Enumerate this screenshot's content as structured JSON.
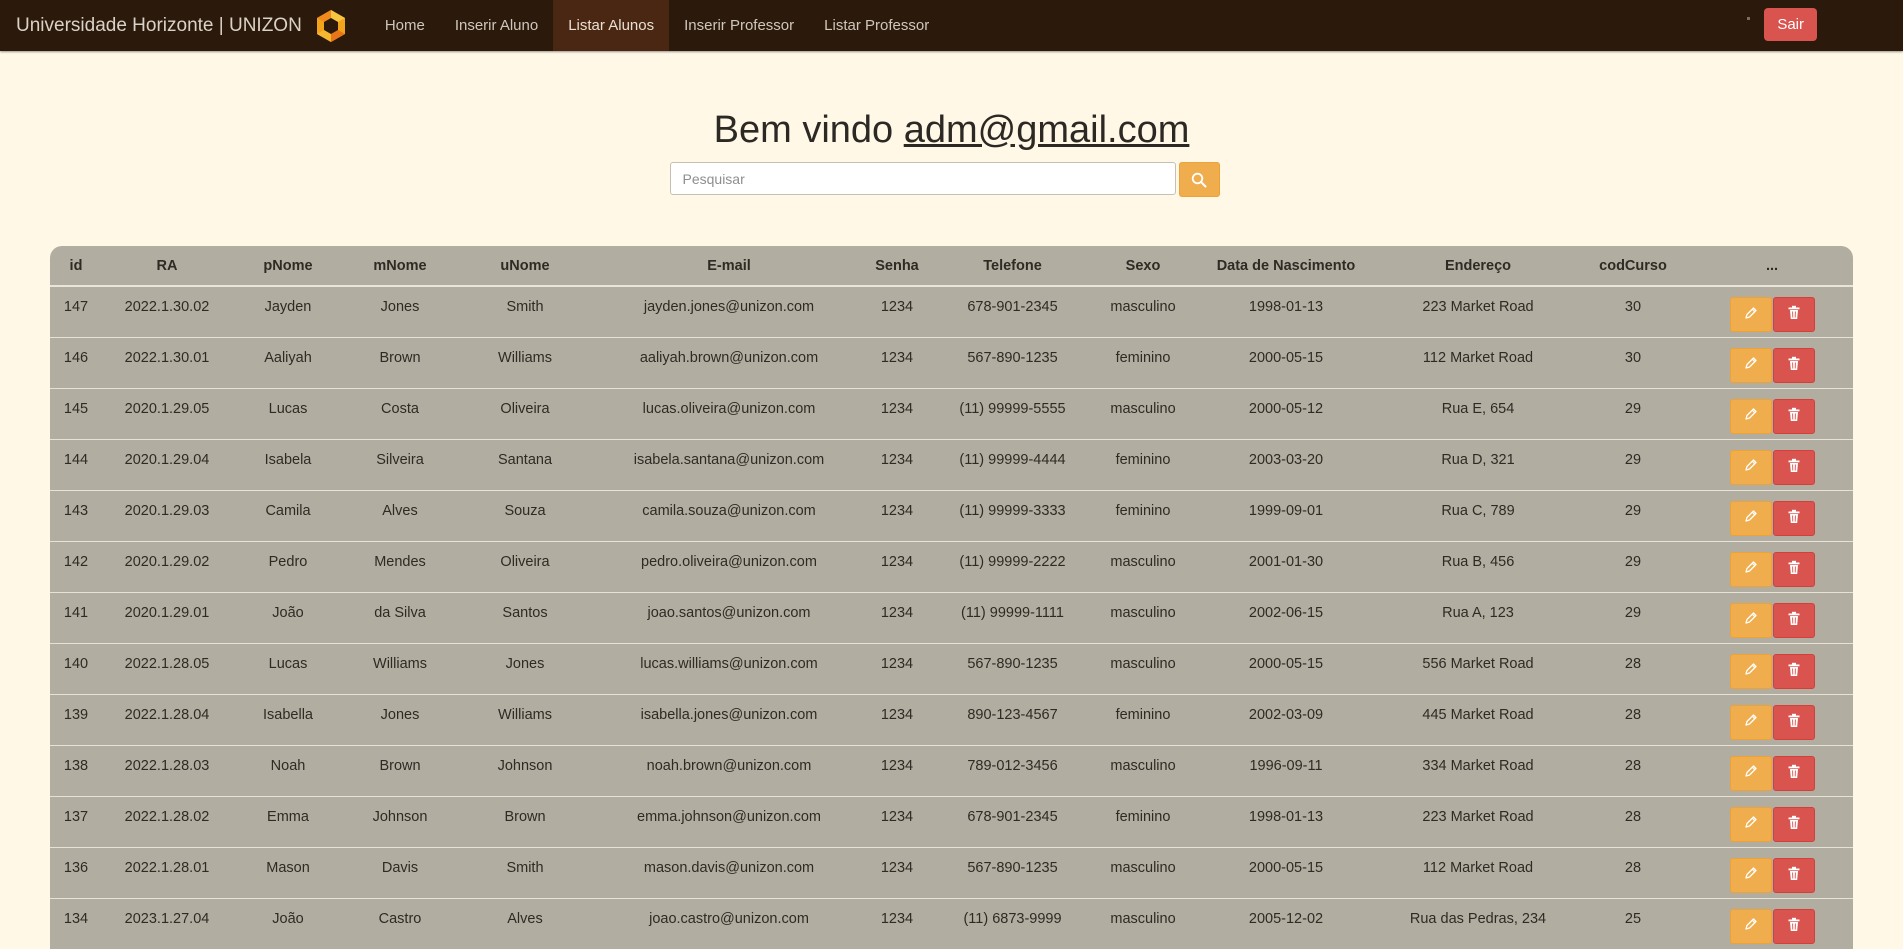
{
  "navbar": {
    "brand": "Universidade Horizonte | UNIZON",
    "items": [
      {
        "label": "Home"
      },
      {
        "label": "Inserir Aluno"
      },
      {
        "label": "Listar Alunos"
      },
      {
        "label": "Inserir Professor"
      },
      {
        "label": "Listar Professor"
      }
    ],
    "active_item": "Listar Alunos",
    "logout_label": "Sair"
  },
  "welcome": {
    "prefix": "Bem vindo ",
    "email": "adm@gmail.com"
  },
  "search": {
    "placeholder": "Pesquisar",
    "icon": "search-icon"
  },
  "colors": {
    "navbar_bg": "#2b1a0c",
    "page_bg": "#fff8e7",
    "table_bg": "#b1aea1",
    "edit_button": "#f0ad4e",
    "delete_button": "#d9534f"
  },
  "table": {
    "columns": [
      "id",
      "RA",
      "pNome",
      "mNome",
      "uNome",
      "E-mail",
      "Senha",
      "Telefone",
      "Sexo",
      "Data de Nascimento",
      "Endereço",
      "codCurso",
      "..."
    ],
    "rows": [
      [
        "147",
        "2022.1.30.02",
        "Jayden",
        "Jones",
        "Smith",
        "jayden.jones@unizon.com",
        "1234",
        "678-901-2345",
        "masculino",
        "1998-01-13",
        "223 Market Road",
        "30"
      ],
      [
        "146",
        "2022.1.30.01",
        "Aaliyah",
        "Brown",
        "Williams",
        "aaliyah.brown@unizon.com",
        "1234",
        "567-890-1235",
        "feminino",
        "2000-05-15",
        "112 Market Road",
        "30"
      ],
      [
        "145",
        "2020.1.29.05",
        "Lucas",
        "Costa",
        "Oliveira",
        "lucas.oliveira@unizon.com",
        "1234",
        "(11) 99999-5555",
        "masculino",
        "2000-05-12",
        "Rua E, 654",
        "29"
      ],
      [
        "144",
        "2020.1.29.04",
        "Isabela",
        "Silveira",
        "Santana",
        "isabela.santana@unizon.com",
        "1234",
        "(11) 99999-4444",
        "feminino",
        "2003-03-20",
        "Rua D, 321",
        "29"
      ],
      [
        "143",
        "2020.1.29.03",
        "Camila",
        "Alves",
        "Souza",
        "camila.souza@unizon.com",
        "1234",
        "(11) 99999-3333",
        "feminino",
        "1999-09-01",
        "Rua C, 789",
        "29"
      ],
      [
        "142",
        "2020.1.29.02",
        "Pedro",
        "Mendes",
        "Oliveira",
        "pedro.oliveira@unizon.com",
        "1234",
        "(11) 99999-2222",
        "masculino",
        "2001-01-30",
        "Rua B, 456",
        "29"
      ],
      [
        "141",
        "2020.1.29.01",
        "João",
        "da Silva",
        "Santos",
        "joao.santos@unizon.com",
        "1234",
        "(11) 99999-1111",
        "masculino",
        "2002-06-15",
        "Rua A, 123",
        "29"
      ],
      [
        "140",
        "2022.1.28.05",
        "Lucas",
        "Williams",
        "Jones",
        "lucas.williams@unizon.com",
        "1234",
        "567-890-1235",
        "masculino",
        "2000-05-15",
        "556 Market Road",
        "28"
      ],
      [
        "139",
        "2022.1.28.04",
        "Isabella",
        "Jones",
        "Williams",
        "isabella.jones@unizon.com",
        "1234",
        "890-123-4567",
        "feminino",
        "2002-03-09",
        "445 Market Road",
        "28"
      ],
      [
        "138",
        "2022.1.28.03",
        "Noah",
        "Brown",
        "Johnson",
        "noah.brown@unizon.com",
        "1234",
        "789-012-3456",
        "masculino",
        "1996-09-11",
        "334 Market Road",
        "28"
      ],
      [
        "137",
        "2022.1.28.02",
        "Emma",
        "Johnson",
        "Brown",
        "emma.johnson@unizon.com",
        "1234",
        "678-901-2345",
        "feminino",
        "1998-01-13",
        "223 Market Road",
        "28"
      ],
      [
        "136",
        "2022.1.28.01",
        "Mason",
        "Davis",
        "Smith",
        "mason.davis@unizon.com",
        "1234",
        "567-890-1235",
        "masculino",
        "2000-05-15",
        "112 Market Road",
        "28"
      ],
      [
        "134",
        "2023.1.27.04",
        "João",
        "Castro",
        "Alves",
        "joao.castro@unizon.com",
        "1234",
        "(11) 6873-9999",
        "masculino",
        "2005-12-02",
        "Rua das Pedras, 234",
        "25"
      ]
    ],
    "row_actions": [
      "pencil-icon",
      "trash-icon"
    ]
  }
}
